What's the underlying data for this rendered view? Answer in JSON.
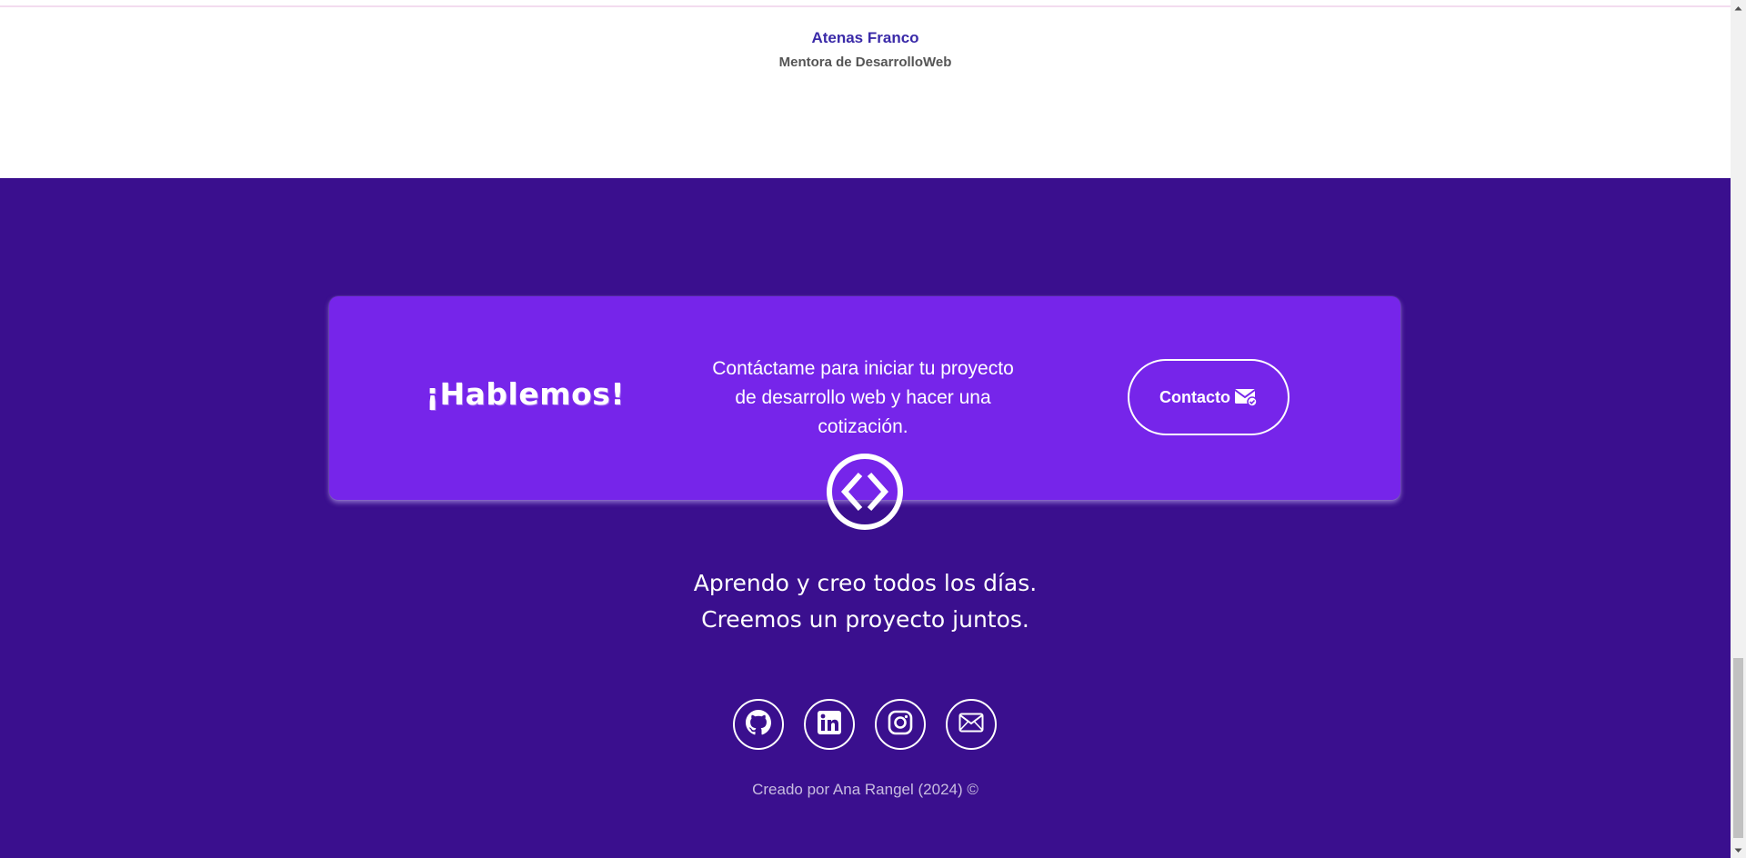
{
  "testimonial": {
    "name": "Atenas Franco",
    "role": "Mentora de DesarrolloWeb"
  },
  "cta": {
    "title": "¡Hablemos!",
    "text": "Contáctame para iniciar tu proyecto de desarrollo web y hacer una cotización.",
    "button_label": "Contacto",
    "button_icon": "mail-check-icon"
  },
  "footer": {
    "logo_icon": "code-circle-icon",
    "slogan_line1": "Aprendo y creo todos los días.",
    "slogan_line2": "Creemos un proyecto juntos.",
    "social": [
      {
        "name": "github-icon"
      },
      {
        "name": "linkedin-icon"
      },
      {
        "name": "instagram-icon"
      },
      {
        "name": "email-icon"
      }
    ],
    "copyright": "Creado por Ana Rangel (2024) ©"
  },
  "colors": {
    "footer_bg": "#3a0f8e",
    "cta_bg": "#7625ea",
    "name_color": "#3a2aa8"
  }
}
